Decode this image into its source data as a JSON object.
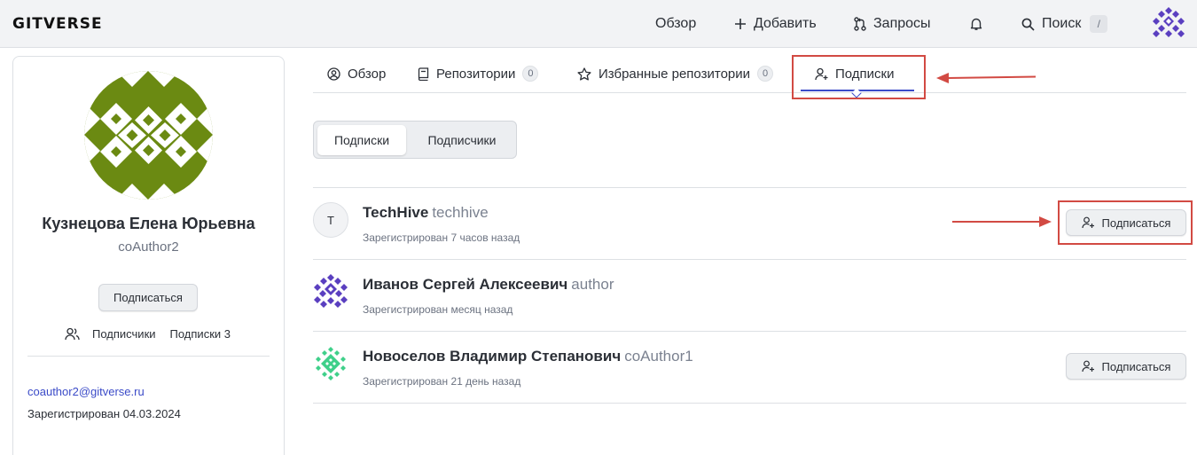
{
  "header": {
    "logo": "GITVERSE",
    "nav": {
      "overview": "Обзор",
      "add": "Добавить",
      "requests": "Запросы",
      "search": "Поиск",
      "search_shortcut": "/"
    }
  },
  "profile": {
    "name": "Кузнецова Елена Юрьевна",
    "login": "coAuthor2",
    "follow_button": "Подписаться",
    "followers_label": "Подписчики",
    "following_label": "Подписки 3",
    "email": "coauthor2@gitverse.ru",
    "registered": "Зарегистрирован 04.03.2024"
  },
  "tabs": {
    "overview": "Обзор",
    "repositories": "Репозитории",
    "repositories_count": "0",
    "starred": "Избранные репозитории",
    "starred_count": "0",
    "following": "Подписки"
  },
  "segment": {
    "following": "Подписки",
    "followers": "Подписчики",
    "active": "following"
  },
  "users": [
    {
      "avatar_letter": "T",
      "name": "TechHive",
      "login": "techhive",
      "registered": "Зарегистрирован 7 часов назад",
      "button": "Подписаться"
    },
    {
      "name": "Иванов Сергей Алексеевич",
      "login": "author",
      "registered": "Зарегистрирован месяц назад"
    },
    {
      "name": "Новоселов Владимир Степанович",
      "login": "coAuthor1",
      "registered": "Зарегистрирован 21 день назад",
      "button": "Подписаться"
    }
  ],
  "colors": {
    "accent": "#3b4bc8",
    "annotation": "#d24a43",
    "avatar_profile": "#6b8a12",
    "avatar_purple": "#5a3fc0",
    "avatar_green": "#3fd08a"
  }
}
